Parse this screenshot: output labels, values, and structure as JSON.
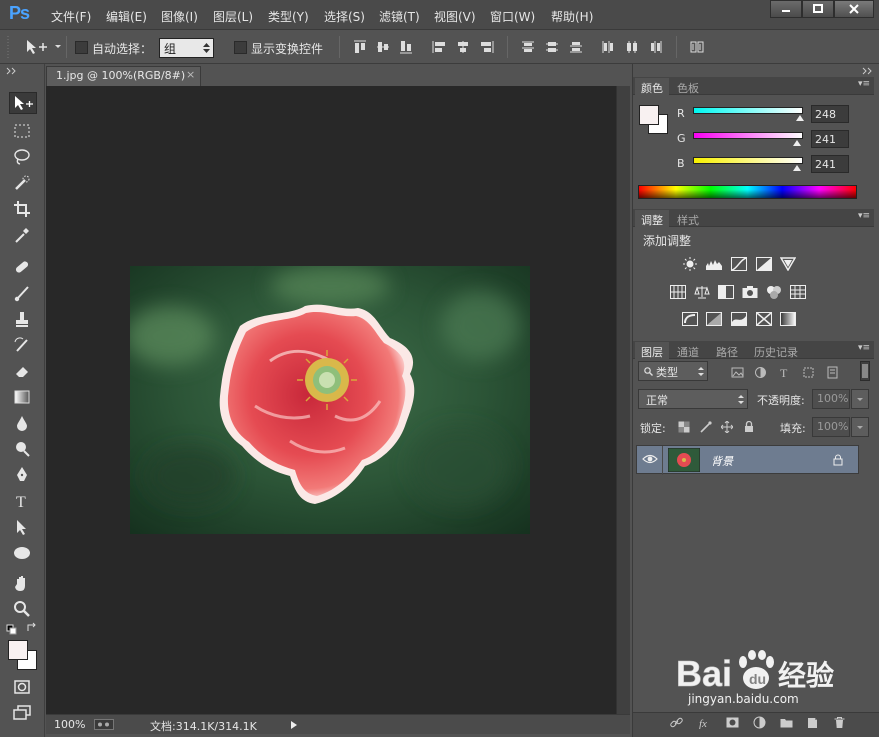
{
  "app": {
    "logo": "Ps"
  },
  "menu": [
    "文件(F)",
    "编辑(E)",
    "图像(I)",
    "图层(L)",
    "类型(Y)",
    "选择(S)",
    "滤镜(T)",
    "视图(V)",
    "窗口(W)",
    "帮助(H)"
  ],
  "options_bar": {
    "auto_select_label": "自动选择：",
    "auto_select_value": "组",
    "show_transform_label": "显示变换控件"
  },
  "document": {
    "tab_title": "1.jpg @ 100%(RGB/8#)",
    "close_glyph": "×"
  },
  "status_bar": {
    "zoom": "100%",
    "doc_info": "文档:314.1K/314.1K"
  },
  "color_panel": {
    "tabs": [
      "颜色",
      "色板"
    ],
    "channels": [
      {
        "label": "R",
        "value": "248",
        "fraction": 0.973
      },
      {
        "label": "G",
        "value": "241",
        "fraction": 0.945
      },
      {
        "label": "B",
        "value": "241",
        "fraction": 0.945
      }
    ],
    "foreground_color": "#f8f1f1",
    "background_color": "#ffffff"
  },
  "adjustments_panel": {
    "tabs": [
      "调整",
      "样式"
    ],
    "heading": "添加调整"
  },
  "layers_panel": {
    "tabs": [
      "图层",
      "通道",
      "路径",
      "历史记录"
    ],
    "filter_kind": "类型",
    "blend_mode": "正常",
    "opacity_label": "不透明度:",
    "opacity_value": "100%",
    "lock_label": "锁定:",
    "fill_label": "填充:",
    "fill_value": "100%",
    "layers": [
      {
        "name": "背景",
        "visible": true,
        "locked": true
      }
    ]
  },
  "watermark": {
    "text": "Baidu经验",
    "url": "jingyan.baidu.com"
  }
}
